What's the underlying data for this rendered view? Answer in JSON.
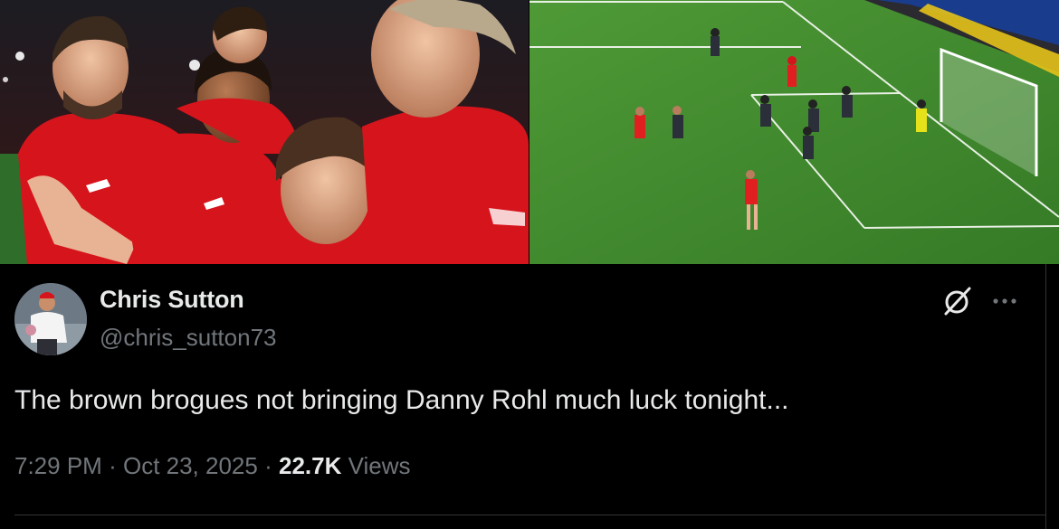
{
  "media": {
    "left_image_icon": "photo-celebration",
    "right_image_icon": "photo-pitch-shot"
  },
  "author": {
    "display_name": "Chris Sutton",
    "handle": "@chris_sutton73",
    "avatar_icon": "avatar-photo"
  },
  "tweet": {
    "text": "The brown brogues not bringing Danny Rohl much luck tonight...",
    "time": "7:29 PM",
    "separator": "·",
    "date": "Oct 23, 2025",
    "views_count": "22.7K",
    "views_label": "Views"
  },
  "icons": {
    "grok": "grok-icon",
    "more": "more-options-icon"
  },
  "colors": {
    "background": "#000000",
    "primary_text": "#e7e9ea",
    "secondary_text": "#71767b",
    "divider": "#2f3336",
    "jersey_red": "#d6141c",
    "pitch_green": "#3f8a2c"
  }
}
